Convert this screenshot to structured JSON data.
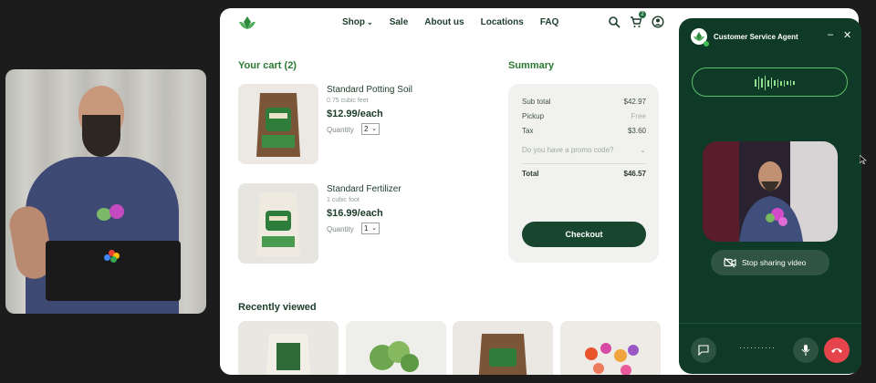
{
  "nav": {
    "menu": [
      "Shop",
      "Sale",
      "About us",
      "Locations",
      "FAQ"
    ],
    "cart_count": "2"
  },
  "cart": {
    "title": "Your cart (2)",
    "items": [
      {
        "name": "Standard Potting Soil",
        "sub": "0.75 cubic feet",
        "price": "$12.99/each",
        "qty_label": "Quantity",
        "qty": "2"
      },
      {
        "name": "Standard Fertilizer",
        "sub": "1 cubic foot",
        "price": "$16.99/each",
        "qty_label": "Quantity",
        "qty": "1"
      }
    ]
  },
  "summary": {
    "title": "Summary",
    "subtotal_label": "Sub total",
    "subtotal": "$42.97",
    "pickup_label": "Pickup",
    "pickup": "Free",
    "tax_label": "Tax",
    "tax": "$3.60",
    "promo": "Do you have a promo code?",
    "total_label": "Total",
    "total": "$46.57",
    "checkout": "Checkout"
  },
  "recent": {
    "title": "Recently viewed"
  },
  "agent": {
    "title": "Customer Service Agent",
    "share_label": "Stop sharing video",
    "status_dots": "··········"
  },
  "colors": {
    "brand_green": "#17452e",
    "accent_green": "#2a7a33",
    "panel": "#0e3a27",
    "end_call": "#e6444d"
  }
}
